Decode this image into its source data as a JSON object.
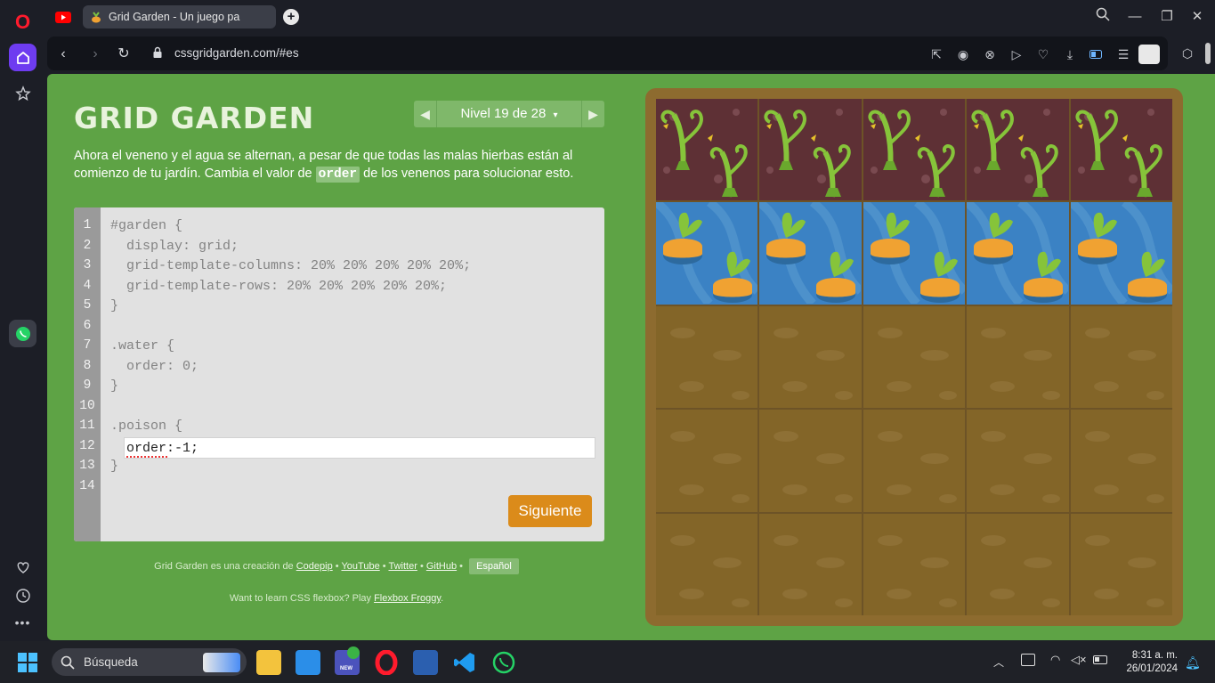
{
  "browser": {
    "tabs": [
      {
        "label": "",
        "icon": "youtube-icon"
      },
      {
        "label": "Grid Garden - Un juego pa",
        "icon": "carrot-icon"
      }
    ],
    "url": "cssgridgarden.com/#es"
  },
  "page": {
    "logo": "GRID GARDEN",
    "level_nav": {
      "prev": "◀",
      "label": "Nivel 19 de 28",
      "dropdown": "▾",
      "next": "▶"
    },
    "instructions": {
      "part1": "Ahora el veneno y el agua se alternan, a pesar de que todas las malas hierbas están al comienzo de tu jardín. Cambia el valor de ",
      "code": "order",
      "part2": " de los venenos para solucionar esto."
    },
    "editor": {
      "line_numbers": [
        "1",
        "2",
        "3",
        "4",
        "5",
        "6",
        "7",
        "8",
        "9",
        "10",
        "11",
        "12",
        "13",
        "14"
      ],
      "lines": [
        "#garden {",
        "  display: grid;",
        "  grid-template-columns: 20% 20% 20% 20% 20%;",
        "  grid-template-rows: 20% 20% 20% 20% 20%;",
        "}",
        "",
        ".water {",
        "  order: 0;",
        "}",
        "",
        ".poison {",
        "",
        "}",
        ""
      ],
      "input_value": "order:-1;",
      "next_button": "Siguiente"
    },
    "credits": {
      "prefix": "Grid Garden es una creación de ",
      "codepip": "Codepip",
      "youtube": "YouTube",
      "twitter": "Twitter",
      "github": "GitHub",
      "sep": " • ",
      "language": "Español"
    },
    "flexbox": {
      "prefix": "Want to learn CSS flexbox? Play ",
      "link": "Flexbox Froggy",
      "suffix": "."
    }
  },
  "garden": {
    "rows": [
      [
        "poison",
        "poison",
        "poison",
        "poison",
        "poison"
      ],
      [
        "water",
        "water",
        "water",
        "water",
        "water"
      ],
      [
        "soil",
        "soil",
        "soil",
        "soil",
        "soil"
      ],
      [
        "soil",
        "soil",
        "soil",
        "soil",
        "soil"
      ],
      [
        "soil",
        "soil",
        "soil",
        "soil",
        "soil"
      ]
    ]
  },
  "taskbar": {
    "search_placeholder": "Búsqueda",
    "time": "8:31 a. m.",
    "date": "26/01/2024",
    "badge": "NEW"
  },
  "colors": {
    "page_bg": "#5ea345",
    "next_button": "#db8b1a",
    "garden_border": "#8d6b2f",
    "water": "#3b82c4",
    "poison": "#5e3035",
    "soil": "#836528"
  }
}
